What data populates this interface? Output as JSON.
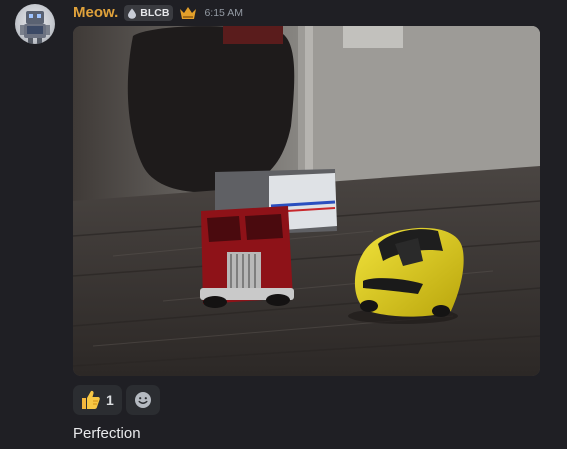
{
  "message": {
    "author": "Meow.",
    "tag": "BLCB",
    "timestamp": "6:15 AM",
    "text": "Perfection"
  },
  "icons": {
    "avatar": "robot-avatar-icon",
    "tag_icon": "drop-badge-icon",
    "role_icon": "gold-crown-icon",
    "add_reaction": "smiley-icon"
  },
  "reactions": [
    {
      "emoji": "thumbs-up",
      "count": "1"
    }
  ],
  "colors": {
    "background": "#1f1f24",
    "username": "#e0a23b",
    "reaction_bg": "#2b2d31"
  }
}
